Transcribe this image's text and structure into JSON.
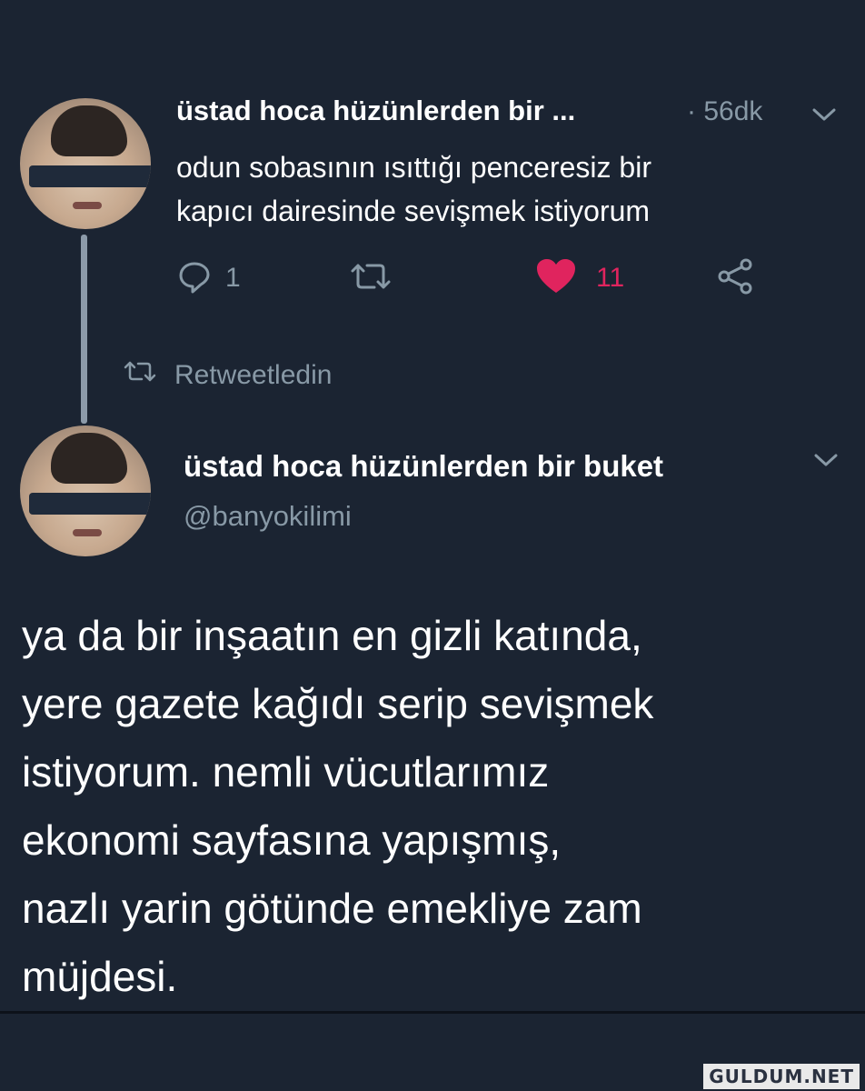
{
  "tweet1": {
    "name": "üstad hoca hüzünlerden bir ...",
    "time": "· 56dk",
    "text_line1": "odun sobasının ısıttığı penceresiz bir",
    "text_line2": "kapıcı dairesinde sevişmek istiyorum",
    "reply_count": "1",
    "like_count": "11"
  },
  "retweet_label": "Retweetledin",
  "tweet2": {
    "name": "üstad hoca hüzünlerden bir buket",
    "handle": "@banyokilimi",
    "lines": [
      "ya da bir inşaatın en gizli katında,",
      "yere gazete kağıdı serip sevişmek",
      "istiyorum. nemli vücutlarımız",
      "ekonomi sayfasına yapışmış,",
      "nazlı yarin götünde emekliye zam",
      "müjdesi."
    ]
  },
  "colors": {
    "background": "#1b2432",
    "secondary_text": "#8899a6",
    "like": "#e0245e"
  },
  "watermark": "GULDUM.NET"
}
